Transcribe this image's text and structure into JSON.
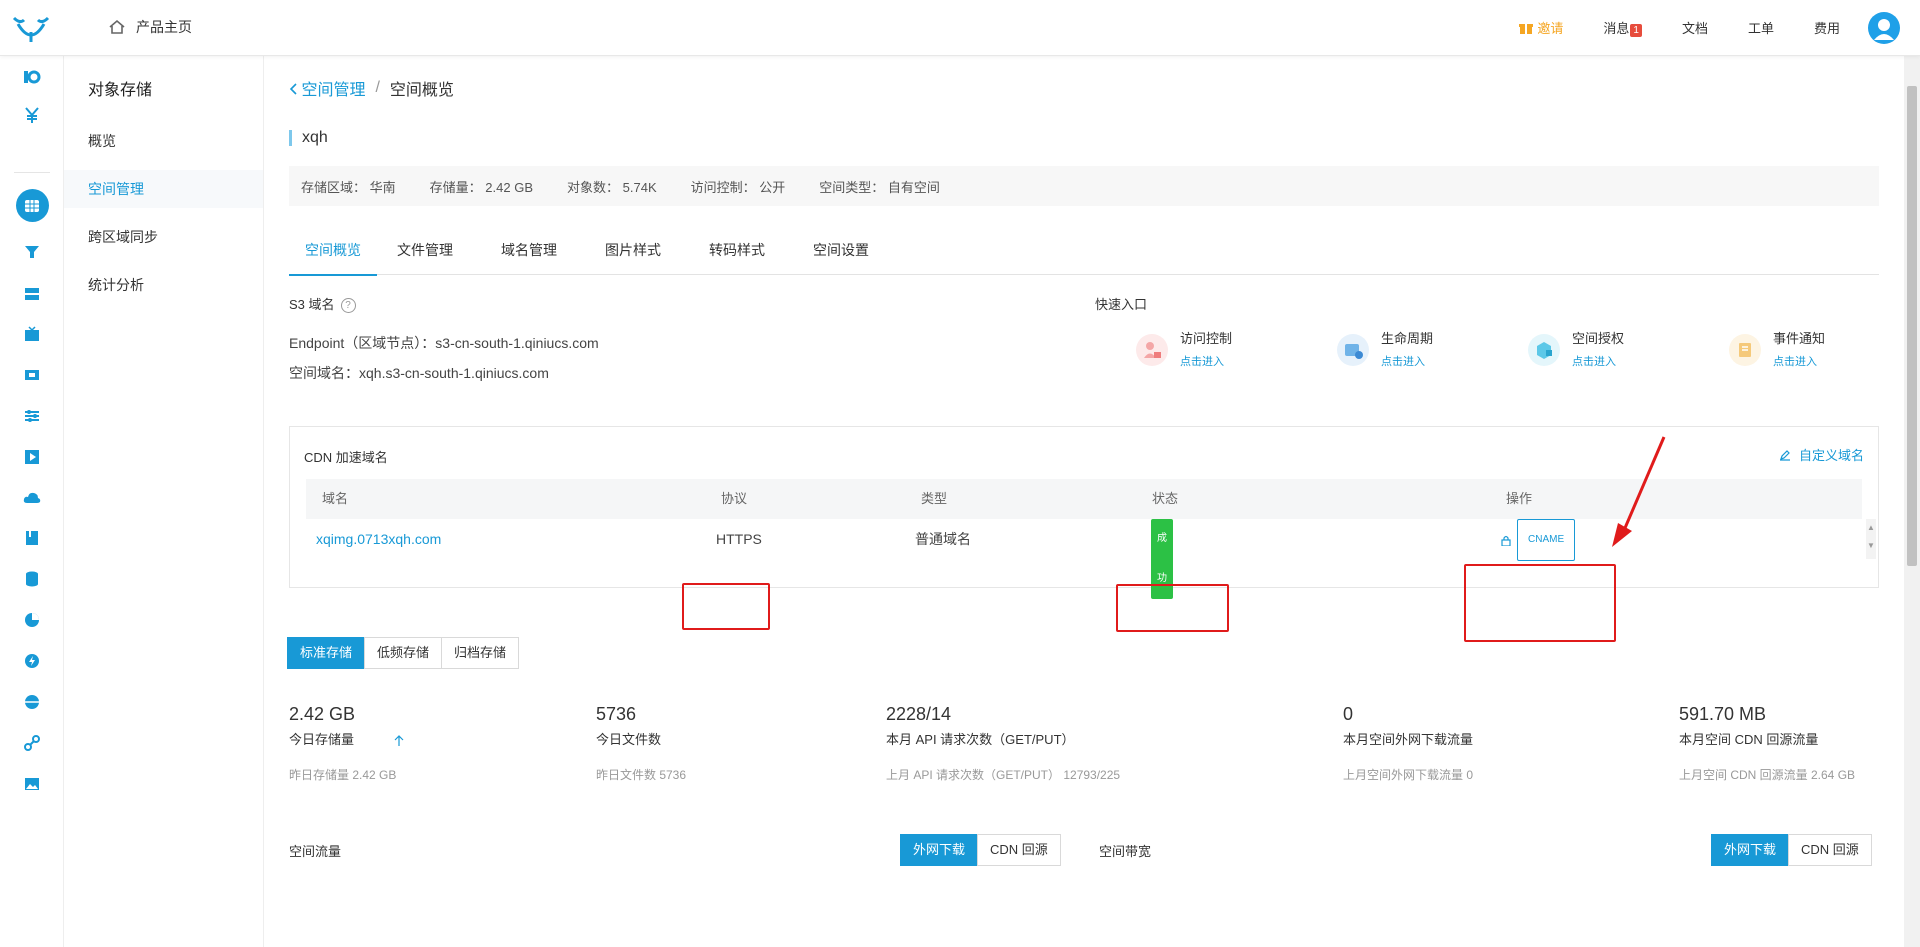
{
  "topbar": {
    "home_label": "产品主页",
    "invite": "邀请",
    "messages": "消息",
    "messages_count": "1",
    "docs": "文档",
    "tickets": "工单",
    "billing": "费用"
  },
  "sidebar": {
    "title": "对象存储",
    "items": [
      {
        "label": "概览"
      },
      {
        "label": "空间管理"
      },
      {
        "label": "跨区域同步"
      },
      {
        "label": "统计分析"
      }
    ]
  },
  "breadcrumb": {
    "parent": "空间管理",
    "separator": "/",
    "current": "空间概览"
  },
  "bucket": {
    "name": "xqh",
    "region_label": "存储区域：",
    "region": "华南",
    "size_label": "存储量：",
    "size": "2.42 GB",
    "objects_label": "对象数：",
    "objects": "5.74K",
    "access_label": "访问控制：",
    "access": "公开",
    "type_label": "空间类型：",
    "type": "自有空间"
  },
  "tabs": [
    "空间概览",
    "文件管理",
    "域名管理",
    "图片样式",
    "转码样式",
    "空间设置"
  ],
  "s3": {
    "title": "S3 域名",
    "endpoint_label": "Endpoint（区域节点）：",
    "endpoint": "s3-cn-south-1.qiniucs.com",
    "domain_label": "空间域名：",
    "domain": "xqh.s3-cn-south-1.qiniucs.com"
  },
  "quick": {
    "title": "快速入口",
    "items": [
      {
        "title": "访问控制",
        "link": "点击进入",
        "color": "#f4a6a6"
      },
      {
        "title": "生命周期",
        "link": "点击进入",
        "color": "#6fb3e8"
      },
      {
        "title": "空间授权",
        "link": "点击进入",
        "color": "#5cc8e8"
      },
      {
        "title": "事件通知",
        "link": "点击进入",
        "color": "#f5c97a"
      }
    ]
  },
  "cdn": {
    "title": "CDN 加速域名",
    "custom_label": "自定义域名",
    "headers": [
      "域名",
      "协议",
      "类型",
      "状态",
      "操作"
    ],
    "row": {
      "domain": "xqimg.0713xqh.com",
      "protocol": "HTTPS",
      "type": "普通域名",
      "status": "成功",
      "action": "CNAME"
    }
  },
  "storage_classes": [
    "标准存储",
    "低频存储",
    "归档存储"
  ],
  "stats": [
    {
      "value": "2.42 GB",
      "label": "今日存储量",
      "sub": "昨日存储量 2.42 GB"
    },
    {
      "value": "5736",
      "label": "今日文件数",
      "sub": "昨日文件数 5736"
    },
    {
      "value": "2228/14",
      "label": "本月 API 请求次数（GET/PUT）",
      "sub": "上月 API 请求次数（GET/PUT） 12793/225"
    },
    {
      "value": "0",
      "label": "本月空间外网下载流量",
      "sub": "上月空间外网下载流量 0"
    },
    {
      "value": "591.70 MB",
      "label": "本月空间 CDN 回源流量",
      "sub": "上月空间 CDN 回源流量 2.64 GB"
    }
  ],
  "traffic": {
    "title": "空间流量",
    "buttons": [
      "外网下载",
      "CDN 回源"
    ]
  },
  "bandwidth": {
    "title": "空间带宽",
    "buttons": [
      "外网下载",
      "CDN 回源"
    ]
  },
  "colors": {
    "accent": "#1899d6",
    "success": "#2cc145",
    "highlight_box": "#e01b1b"
  }
}
